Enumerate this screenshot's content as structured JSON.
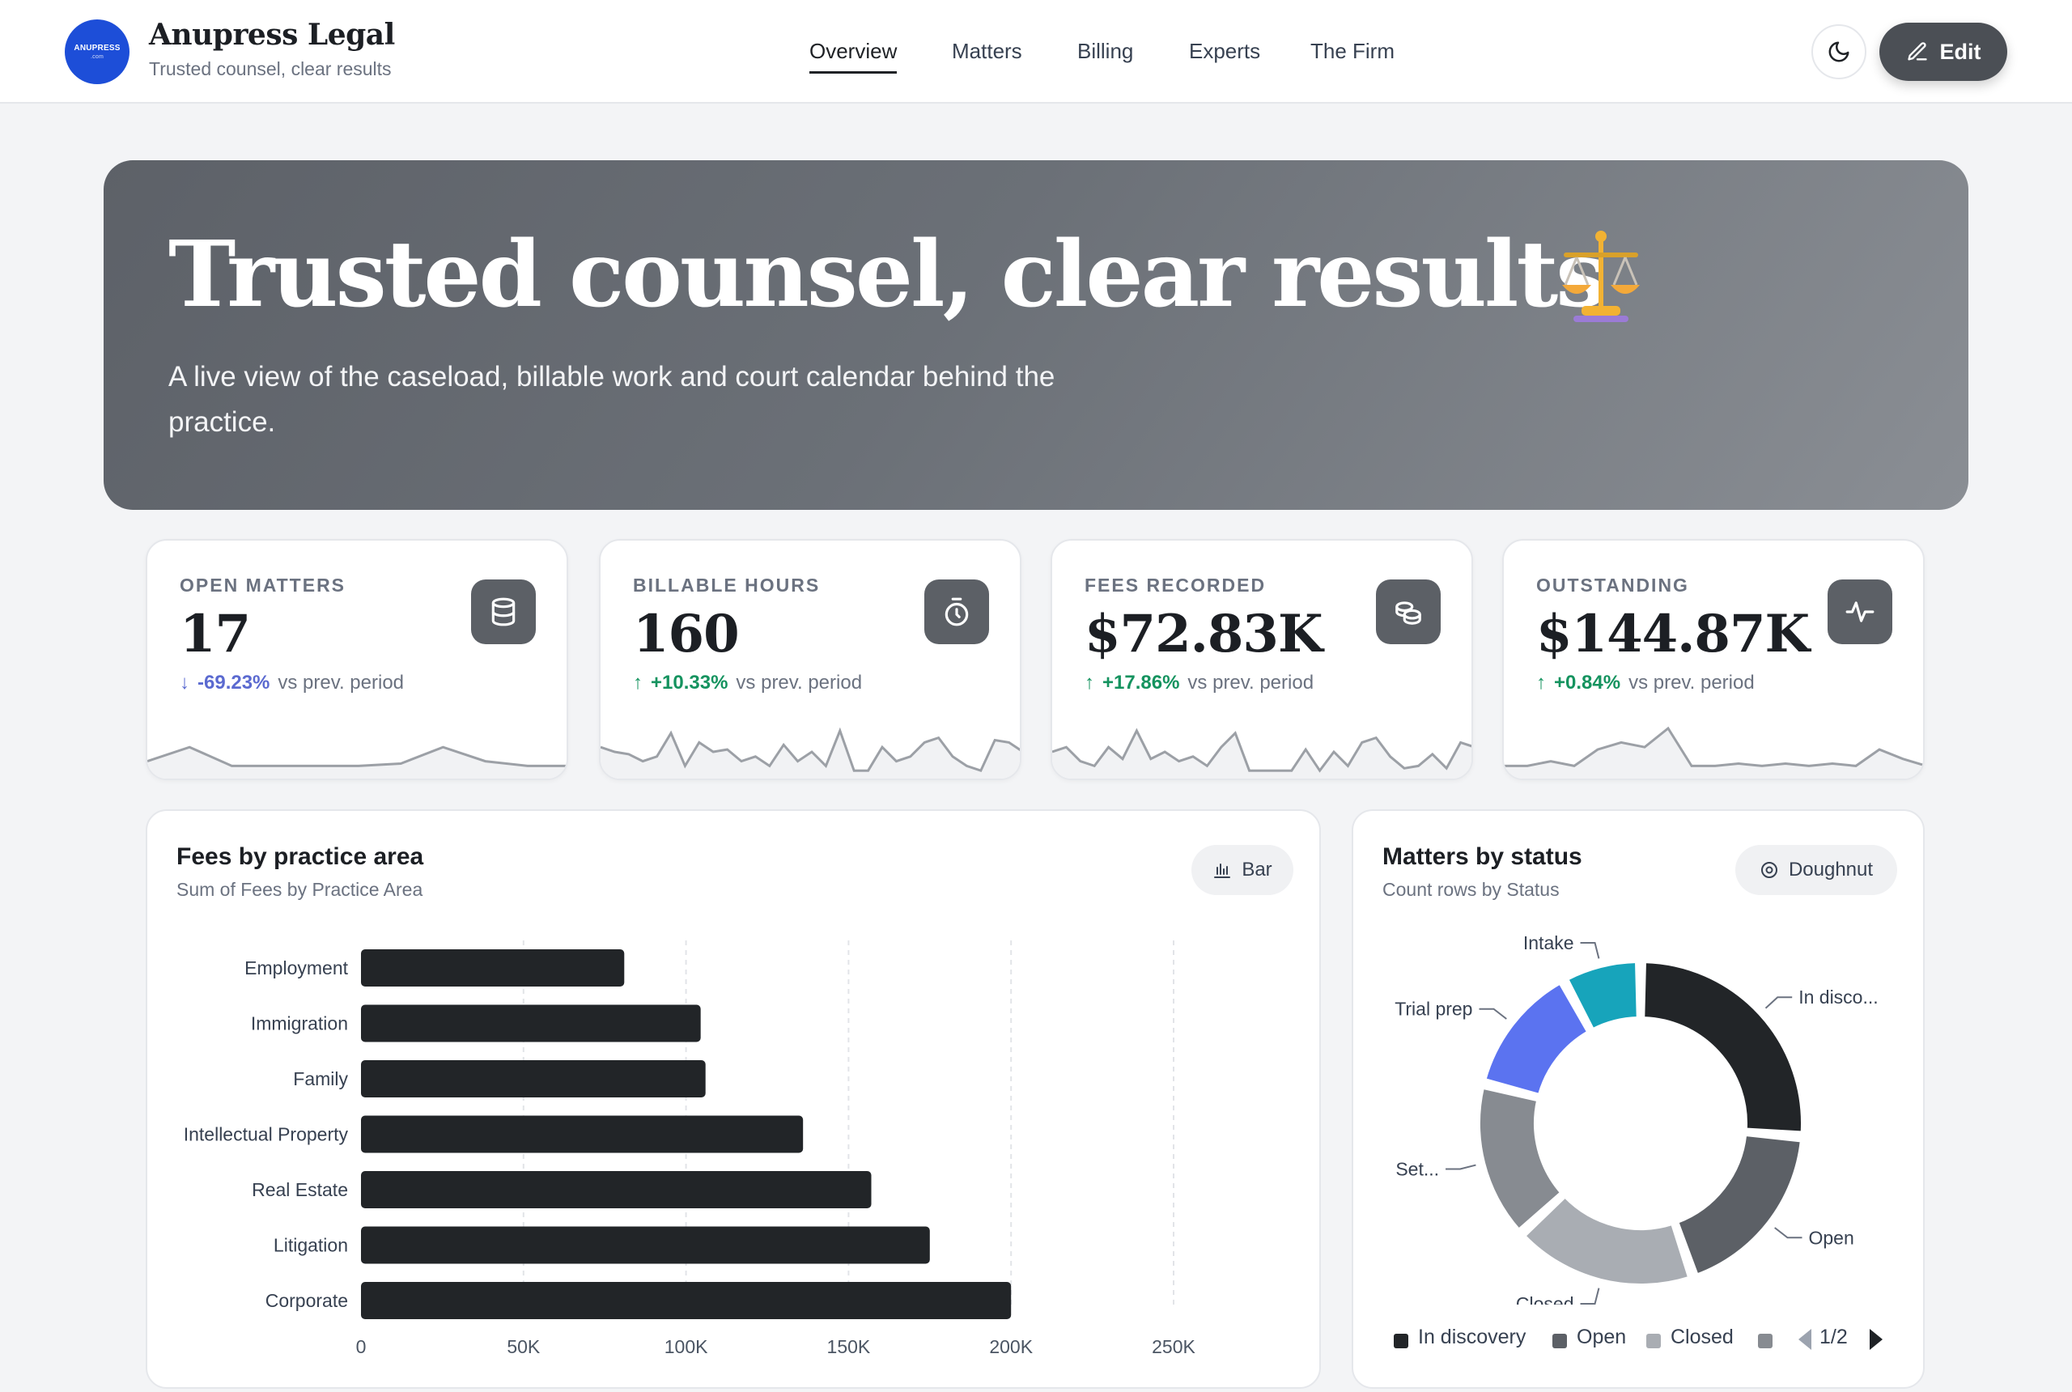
{
  "brand": {
    "logo_text": "ANUPRESS",
    "logo_sub": ".com",
    "name": "Anupress Legal",
    "tagline": "Trusted counsel, clear results"
  },
  "nav": {
    "items": [
      "Overview",
      "Matters",
      "Billing",
      "Experts",
      "The Firm"
    ],
    "active": "Overview"
  },
  "header_actions": {
    "theme_icon": "moon-icon",
    "edit_label": "Edit"
  },
  "hero": {
    "title": "Trusted counsel, clear results",
    "emoji": "⚖️",
    "subtitle": "A live view of the caseload, billable work and court calendar behind the practice."
  },
  "kpis": [
    {
      "label": "OPEN MATTERS",
      "value": "17",
      "delta": "-69.23%",
      "direction": "down",
      "suffix": "vs prev. period",
      "icon": "database-icon",
      "spark": [
        0.3,
        0.6,
        0.2,
        0.2,
        0.2,
        0.2,
        0.25,
        0.6,
        0.3,
        0.2,
        0.2
      ]
    },
    {
      "label": "BILLABLE HOURS",
      "value": "160",
      "delta": "+10.33%",
      "direction": "up",
      "suffix": "vs prev. period",
      "icon": "timer-icon",
      "spark": [
        0.6,
        0.5,
        0.45,
        0.3,
        0.4,
        0.9,
        0.2,
        0.7,
        0.5,
        0.55,
        0.3,
        0.4,
        0.2,
        0.65,
        0.3,
        0.5,
        0.2,
        0.95,
        0.1,
        0.1,
        0.6,
        0.3,
        0.4,
        0.7,
        0.8,
        0.4,
        0.2,
        0.1,
        0.75,
        0.7,
        0.5
      ]
    },
    {
      "label": "FEES RECORDED",
      "value": "$72.83K",
      "delta": "+17.86%",
      "direction": "up",
      "suffix": "vs prev. period",
      "icon": "coins-icon",
      "spark": [
        0.5,
        0.6,
        0.3,
        0.2,
        0.6,
        0.35,
        0.95,
        0.35,
        0.5,
        0.3,
        0.4,
        0.2,
        0.6,
        0.9,
        0.1,
        0.1,
        0.1,
        0.1,
        0.55,
        0.1,
        0.5,
        0.2,
        0.7,
        0.8,
        0.4,
        0.15,
        0.2,
        0.45,
        0.15,
        0.7,
        0.6
      ]
    },
    {
      "label": "OUTSTANDING",
      "value": "$144.87K",
      "delta": "+0.84%",
      "direction": "up",
      "suffix": "vs prev. period",
      "icon": "activity-icon",
      "spark": [
        0.2,
        0.2,
        0.3,
        0.2,
        0.55,
        0.7,
        0.6,
        1.0,
        0.2,
        0.2,
        0.25,
        0.2,
        0.25,
        0.2,
        0.25,
        0.2,
        0.55,
        0.35,
        0.2
      ]
    }
  ],
  "fees_panel": {
    "title": "Fees by practice area",
    "subtitle": "Sum of Fees by Practice Area",
    "toggle_label": "Bar",
    "toggle_icon": "bar-chart-icon"
  },
  "status_panel": {
    "title": "Matters by status",
    "subtitle": "Count rows by Status",
    "toggle_label": "Doughnut",
    "toggle_icon": "doughnut-icon",
    "legend": [
      "In discovery",
      "Open",
      "Closed"
    ],
    "legend_page": "1/2"
  },
  "chart_data": [
    {
      "type": "bar",
      "orientation": "horizontal",
      "categories": [
        "Employment",
        "Immigration",
        "Family",
        "Intellectual Property",
        "Real Estate",
        "Litigation",
        "Corporate"
      ],
      "values": [
        81000,
        104500,
        106000,
        136000,
        157000,
        175000,
        200000
      ],
      "xlim": [
        0,
        250000
      ],
      "x_ticks": [
        "0",
        "50K",
        "100K",
        "150K",
        "200K",
        "250K"
      ],
      "bar_color": "#222528",
      "grid": true
    },
    {
      "type": "pie",
      "variant": "doughnut",
      "labels": [
        "In disco...",
        "Open",
        "Closed",
        "Set...",
        "Trial prep",
        "Intake"
      ],
      "values": [
        5,
        3.5,
        3.5,
        3,
        2.5,
        1.5
      ],
      "colors": [
        "#222528",
        "#5c6066",
        "#a9adb3",
        "#878b91",
        "#5b73f0",
        "#17a4bb"
      ],
      "legend": "bottom"
    }
  ]
}
